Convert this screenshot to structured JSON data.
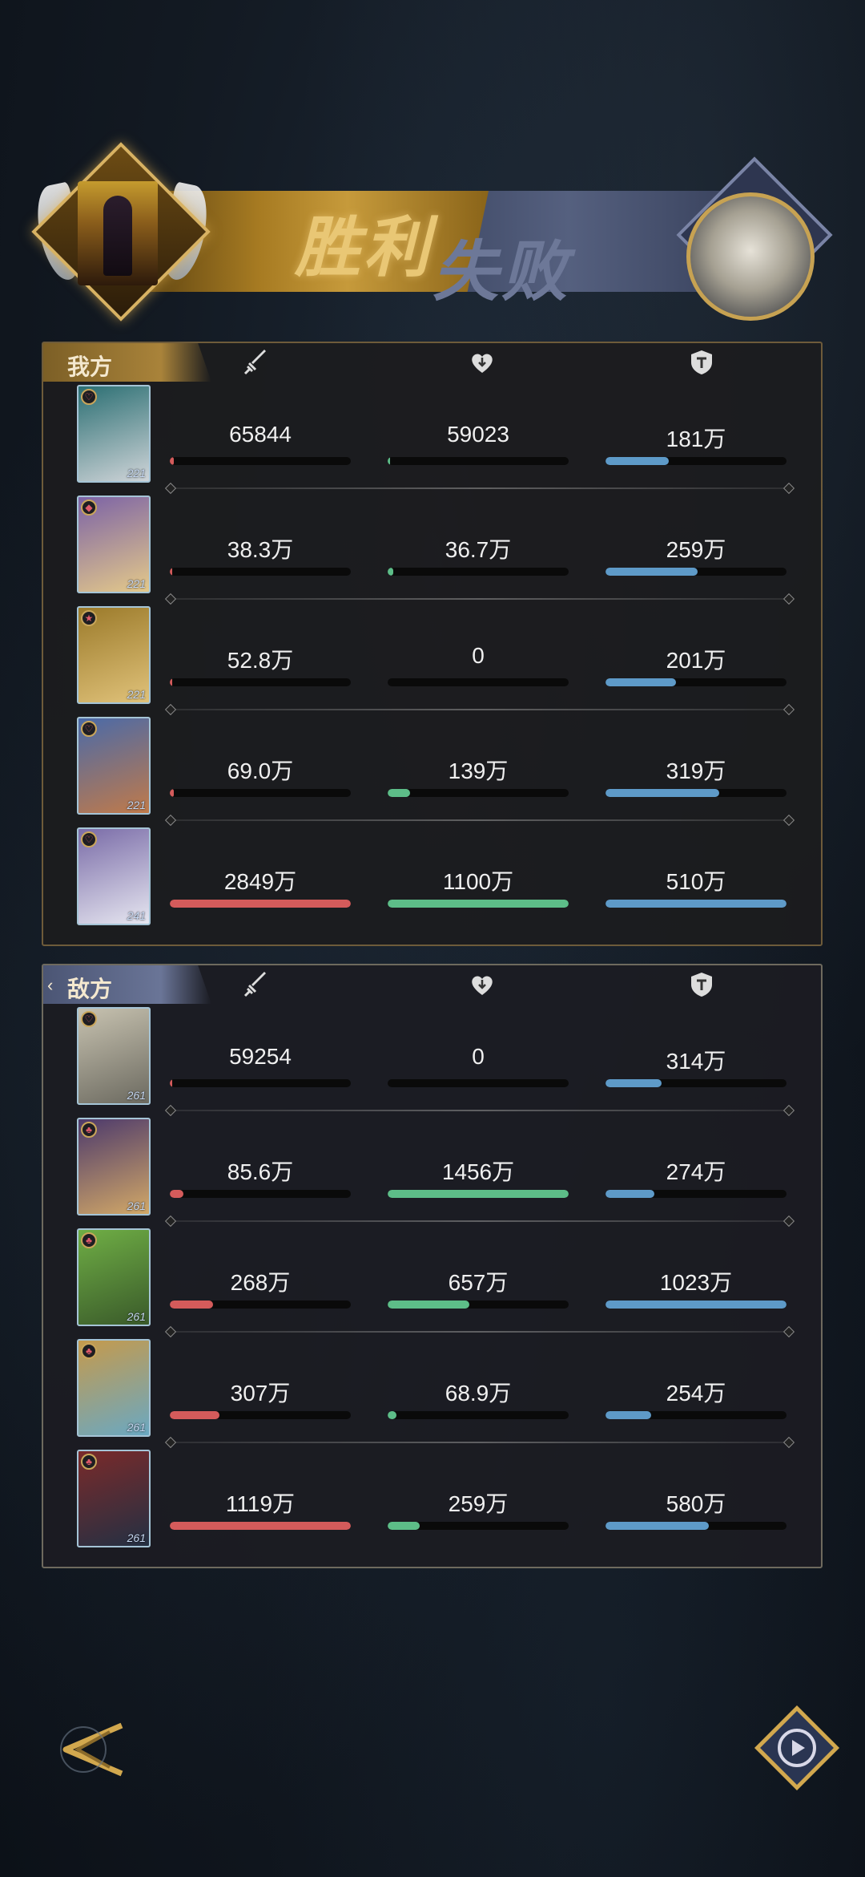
{
  "banner": {
    "win": "胜利",
    "lose": "失败"
  },
  "ally": {
    "title": "我方",
    "rows": [
      {
        "level": "221",
        "badge": "♡",
        "card_colors": [
          "#2b6f73",
          "#cfd4d8"
        ],
        "damage": "65844",
        "damage_pct": 0.02,
        "heal": "59023",
        "heal_pct": 0.01,
        "tank": "181万",
        "tank_pct": 0.35
      },
      {
        "level": "221",
        "badge": "◆",
        "card_colors": [
          "#7c63a6",
          "#e4c98a"
        ],
        "damage": "38.3万",
        "damage_pct": 0.013,
        "heal": "36.7万",
        "heal_pct": 0.03,
        "tank": "259万",
        "tank_pct": 0.51
      },
      {
        "level": "221",
        "badge": "★",
        "card_colors": [
          "#9b7a2a",
          "#e0c27a"
        ],
        "damage": "52.8万",
        "damage_pct": 0.018,
        "heal": "0",
        "heal_pct": 0,
        "tank": "201万",
        "tank_pct": 0.39
      },
      {
        "level": "221",
        "badge": "♡",
        "card_colors": [
          "#4a6aa8",
          "#c07a4a"
        ],
        "damage": "69.0万",
        "damage_pct": 0.024,
        "heal": "139万",
        "heal_pct": 0.126,
        "tank": "319万",
        "tank_pct": 0.63
      },
      {
        "level": "241",
        "badge": "♡",
        "card_colors": [
          "#7a6ca8",
          "#e6e6f0"
        ],
        "damage": "2849万",
        "damage_pct": 1.0,
        "heal": "1100万",
        "heal_pct": 1.0,
        "tank": "510万",
        "tank_pct": 1.0
      }
    ]
  },
  "enemy": {
    "title": "敌方",
    "rows": [
      {
        "level": "261",
        "badge": "♡",
        "card_colors": [
          "#c7c2b0",
          "#6c6a60"
        ],
        "damage": "59254",
        "damage_pct": 0.005,
        "heal": "0",
        "heal_pct": 0,
        "tank": "314万",
        "tank_pct": 0.31
      },
      {
        "level": "261",
        "badge": "♣",
        "card_colors": [
          "#4d3a6c",
          "#d2a867"
        ],
        "damage": "85.6万",
        "damage_pct": 0.077,
        "heal": "1456万",
        "heal_pct": 1.0,
        "tank": "274万",
        "tank_pct": 0.27
      },
      {
        "level": "261",
        "badge": "♣",
        "card_colors": [
          "#6fae45",
          "#3a5a2a"
        ],
        "damage": "268万",
        "damage_pct": 0.24,
        "heal": "657万",
        "heal_pct": 0.45,
        "tank": "1023万",
        "tank_pct": 1.0
      },
      {
        "level": "261",
        "badge": "♣",
        "card_colors": [
          "#c59a4c",
          "#6aa8c2"
        ],
        "damage": "307万",
        "damage_pct": 0.275,
        "heal": "68.9万",
        "heal_pct": 0.047,
        "tank": "254万",
        "tank_pct": 0.25
      },
      {
        "level": "261",
        "badge": "♣",
        "card_colors": [
          "#7a2a2a",
          "#243043"
        ],
        "damage": "1119万",
        "damage_pct": 1.0,
        "heal": "259万",
        "heal_pct": 0.178,
        "tank": "580万",
        "tank_pct": 0.57
      }
    ]
  },
  "icons": {
    "damage": "sword-icon",
    "heal": "heart-icon",
    "tank": "shield-icon",
    "back": "back-arrow-icon",
    "replay": "replay-icon"
  },
  "colors": {
    "damage": "#d45b5b",
    "heal": "#5dbd88",
    "tank": "#5e9ac8",
    "gold": "#c69a3b"
  }
}
